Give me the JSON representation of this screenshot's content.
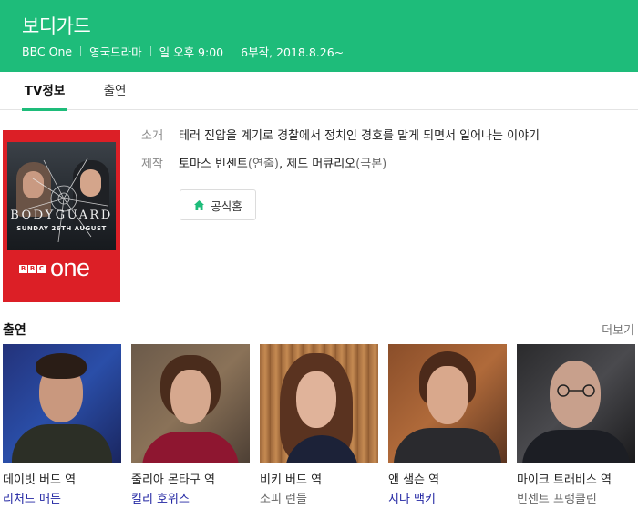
{
  "header": {
    "title": "보디가드",
    "meta": [
      "BBC One",
      "영국드라마",
      "일 오후 9:00",
      "6부작, 2018.8.26~"
    ]
  },
  "tabs": [
    {
      "label": "TV정보",
      "active": true
    },
    {
      "label": "출연",
      "active": false
    }
  ],
  "poster": {
    "title": "BODYGUARD",
    "date": "SUNDAY 26TH AUGUST",
    "channel_logo": [
      "B",
      "B",
      "C"
    ],
    "channel_word": "one"
  },
  "info": {
    "intro_label": "소개",
    "intro_text": "테러 진압을 계기로 경찰에서 정치인 경호를 맡게 되면서 일어나는 이야기",
    "staff_label": "제작",
    "staff": [
      {
        "name": "토마스 빈센트",
        "role": "(연출)"
      },
      {
        "name": "제드 머큐리오",
        "role": "(극본)"
      }
    ],
    "home_button": "공식홈"
  },
  "cast_section": {
    "title": "출연",
    "more": "더보기",
    "items": [
      {
        "role": "데이빗 버드 역",
        "actor": "리처드 매든",
        "linked": true
      },
      {
        "role": "줄리아 몬타구 역",
        "actor": "킬리 호위스",
        "linked": true
      },
      {
        "role": "비키 버드 역",
        "actor": "소피 런들",
        "linked": false
      },
      {
        "role": "앤 샘슨 역",
        "actor": "지나 맥키",
        "linked": true
      },
      {
        "role": "마이크 트래비스 역",
        "actor": "빈센트 프랭클린",
        "linked": false
      }
    ]
  },
  "colors": {
    "brand_green": "#1ebc7a",
    "link_blue": "#2226a3",
    "poster_red": "#dc1f26"
  }
}
